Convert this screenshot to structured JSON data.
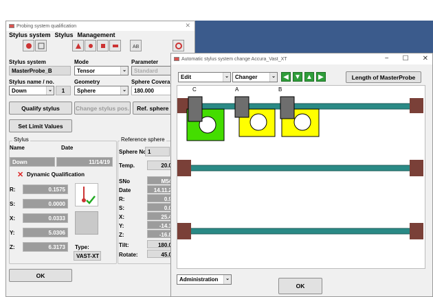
{
  "left_window": {
    "title": "Probing system qualification",
    "menu": [
      "Stylus system",
      "Stylus",
      "Management"
    ],
    "stylus_system_label": "Stylus system",
    "stylus_system_value": "MasterProbe_B",
    "mode_label": "Mode",
    "mode_value": "Tensor",
    "parameter_label": "Parameter",
    "parameter_value": "Standard",
    "stylus_name_label": "Stylus name / no.",
    "stylus_name_value": "Down",
    "stylus_no_value": "1",
    "geometry_label": "Geometry",
    "geometry_value": "Sphere",
    "sphere_cover_label": "Sphere Covera",
    "sphere_cover_value": "180.000",
    "qualify_stylus": "Qualify stylus",
    "change_stylus_pos": "Change stylus pos.",
    "ref_sphere": "Ref. sphere p",
    "set_limit_values": "Set Limit Values",
    "stylus_group": "Stylus",
    "name_header": "Name",
    "date_header": "Date",
    "stylus_name_row": "Down",
    "stylus_date_row": "11/14/19",
    "dynamic_qualification": "Dynamic Qualification",
    "r_label": "R:",
    "r_value": "0.1575",
    "s_label": "S:",
    "s_value": "0.0000",
    "x_label": "X:",
    "x_value": "0.0333",
    "y_label": "Y:",
    "y_value": "5.0306",
    "z_label": "Z:",
    "z_value": "6.3173",
    "type_label": "Type:",
    "type_value": "VAST-XT",
    "ref_group": "Reference sphere",
    "sphere_no_label": "Sphere No.",
    "sphere_no_value": "1",
    "temp_label": "Temp.",
    "temp_value": "20.0",
    "sno_label": "SNo",
    "sno_value": "M54",
    "date_label": "Date",
    "date_value": "14.11.2",
    "r2_label": "R:",
    "r2_value": "0.9",
    "s2_label": "S:",
    "s2_value": "0.0",
    "x2_label": "X:",
    "x2_value": "25.4",
    "y2_label": "Y:",
    "y2_value": "-14.1",
    "z2_label": "Z:",
    "z2_value": "-16.8",
    "tilt_label": "Tilt:",
    "tilt_value": "180.0",
    "rotate_label": "Rotate:",
    "rotate_value": "45.0",
    "ok": "OK"
  },
  "right_window": {
    "title": "Automatic stylus system change Accura_Vast_XT",
    "minimize": "−",
    "maximize": "☐",
    "close": "✕",
    "edit_value": "Edit",
    "changer_value": "Changer",
    "length_button": "Length of MasterProbe",
    "port_c": "C",
    "port_a": "A",
    "port_b": "B",
    "administration_value": "Administration",
    "ok": "OK"
  },
  "colors": {
    "rail": "#2a8a86",
    "end_block": "#7a4038",
    "yellow": "#ffff00",
    "green": "#44dd00",
    "gray_block": "#6e6e6e",
    "blue_bg": "#3b5b8c"
  }
}
